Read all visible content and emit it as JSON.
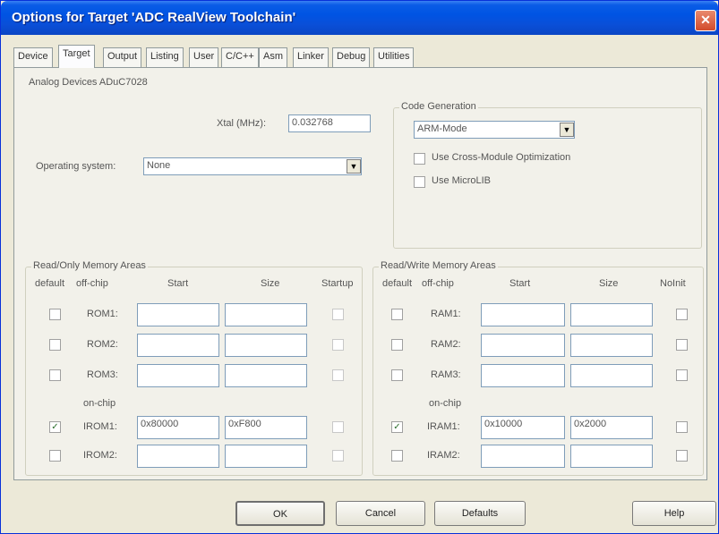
{
  "window": {
    "title": "Options for Target 'ADC RealView Toolchain'",
    "close_glyph": "✕"
  },
  "tabs": [
    {
      "label": "Device"
    },
    {
      "label": "Target"
    },
    {
      "label": "Output"
    },
    {
      "label": "Listing"
    },
    {
      "label": "User"
    },
    {
      "label": "C/C++"
    },
    {
      "label": "Asm"
    },
    {
      "label": "Linker"
    },
    {
      "label": "Debug"
    },
    {
      "label": "Utilities"
    }
  ],
  "active_tab": "Target",
  "target": {
    "device_name": "Analog Devices ADuC7028",
    "xtal_label": "Xtal (MHz):",
    "xtal_value": "0.032768",
    "os_label": "Operating system:",
    "os_value": "None"
  },
  "code_generation": {
    "title": "Code Generation",
    "mode_value": "ARM-Mode",
    "cross_module_label": "Use Cross-Module Optimization",
    "microlib_label": "Use MicroLIB"
  },
  "rom": {
    "title": "Read/Only Memory Areas",
    "headers": {
      "default": "default",
      "offchip": "off-chip",
      "start": "Start",
      "size": "Size",
      "last": "Startup"
    },
    "onchip_label": "on-chip",
    "rows": [
      {
        "label": "ROM1:",
        "start": "",
        "size": "",
        "default": false
      },
      {
        "label": "ROM2:",
        "start": "",
        "size": "",
        "default": false
      },
      {
        "label": "ROM3:",
        "start": "",
        "size": "",
        "default": false
      },
      {
        "label": "IROM1:",
        "start": "0x80000",
        "size": "0xF800",
        "default": true
      },
      {
        "label": "IROM2:",
        "start": "",
        "size": "",
        "default": false
      }
    ]
  },
  "ram": {
    "title": "Read/Write Memory Areas",
    "headers": {
      "default": "default",
      "offchip": "off-chip",
      "start": "Start",
      "size": "Size",
      "last": "NoInit"
    },
    "onchip_label": "on-chip",
    "rows": [
      {
        "label": "RAM1:",
        "start": "",
        "size": "",
        "default": false
      },
      {
        "label": "RAM2:",
        "start": "",
        "size": "",
        "default": false
      },
      {
        "label": "RAM3:",
        "start": "",
        "size": "",
        "default": false
      },
      {
        "label": "IRAM1:",
        "start": "0x10000",
        "size": "0x2000",
        "default": true
      },
      {
        "label": "IRAM2:",
        "start": "",
        "size": "",
        "default": false
      }
    ]
  },
  "buttons": {
    "ok": "OK",
    "cancel": "Cancel",
    "defaults": "Defaults",
    "help": "Help"
  },
  "check_glyph": "✓",
  "dropdown_glyph": "▼"
}
